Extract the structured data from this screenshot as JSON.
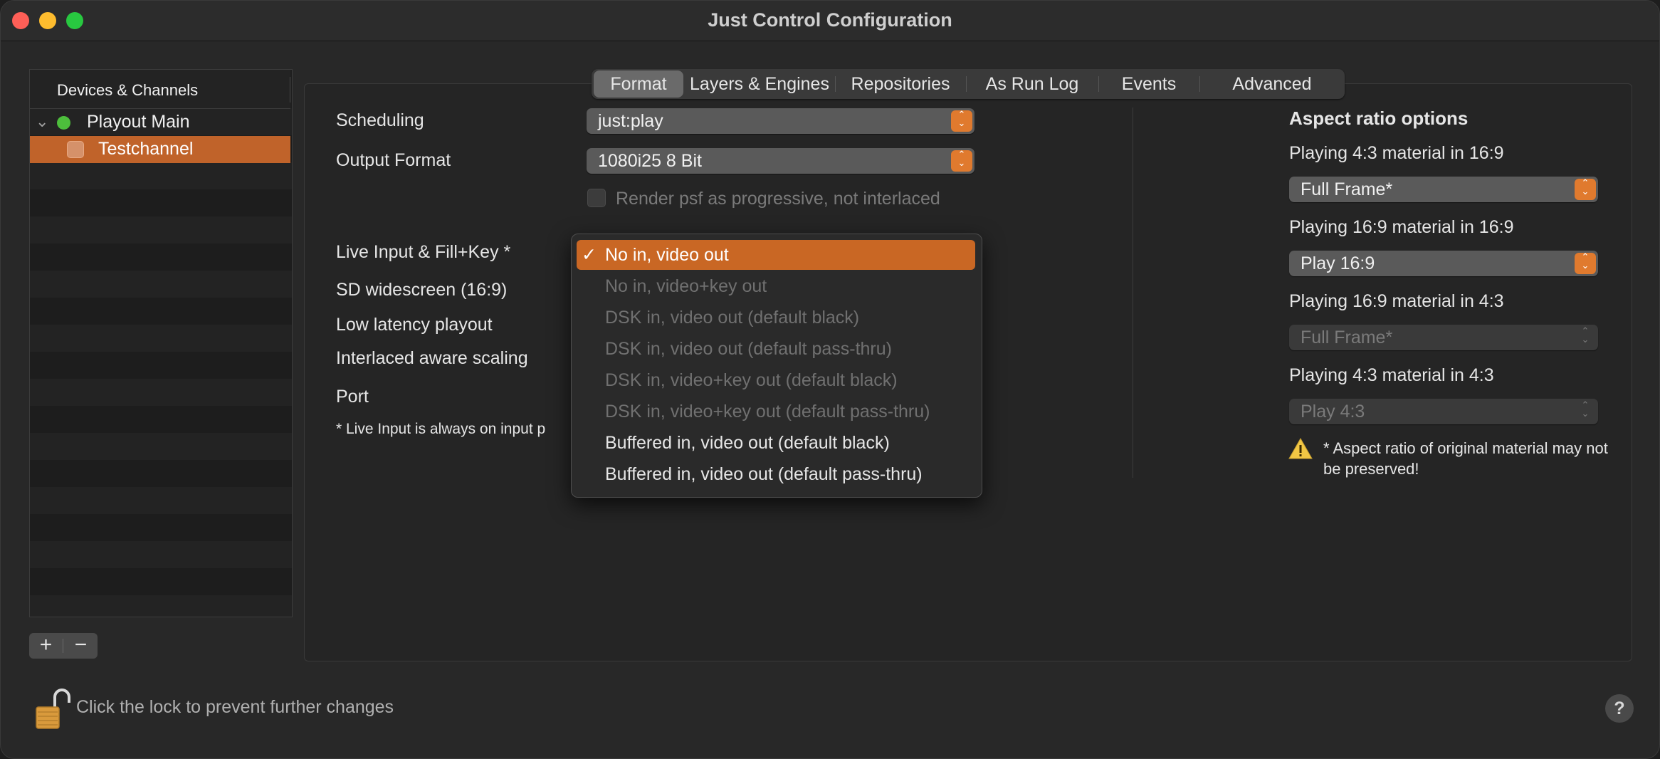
{
  "window": {
    "title": "Just Control Configuration"
  },
  "sidebar": {
    "header": "Devices & Channels",
    "items": [
      {
        "label": "Playout Main",
        "status_color": "#4dbe3c"
      },
      {
        "label": "Testchannel"
      }
    ],
    "add_label": "+",
    "remove_label": "−"
  },
  "tabs": [
    "Format",
    "Layers & Engines",
    "Repositories",
    "As Run Log",
    "Events",
    "Advanced"
  ],
  "selected_tab": "Format",
  "form": {
    "scheduling_label": "Scheduling",
    "scheduling_value": "just:play",
    "output_format_label": "Output Format",
    "output_format_value": "1080i25 8 Bit",
    "render_psf_label": "Render psf as progressive, not interlaced",
    "live_input_label": "Live Input & Fill+Key *",
    "sd_widescreen_label": "SD widescreen (16:9)",
    "low_latency_label": "Low latency playout",
    "interlaced_label": "Interlaced aware scaling",
    "port_label": "Port",
    "footnote": "* Live Input is always on input p"
  },
  "live_input_menu": {
    "items": [
      {
        "label": "No in, video out",
        "state": "selected"
      },
      {
        "label": "No in, video+key out",
        "state": "disabled"
      },
      {
        "label": "DSK in, video out (default black)",
        "state": "disabled"
      },
      {
        "label": "DSK in, video out (default pass-thru)",
        "state": "disabled"
      },
      {
        "label": "DSK in, video+key out (default black)",
        "state": "disabled"
      },
      {
        "label": "DSK in, video+key out (default pass-thru)",
        "state": "disabled"
      },
      {
        "label": "Buffered in, video out (default black)",
        "state": "enabled"
      },
      {
        "label": "Buffered in, video out (default pass-thru)",
        "state": "enabled"
      }
    ]
  },
  "aspect": {
    "title": "Aspect ratio options",
    "rows": [
      {
        "label": "Playing 4:3 material in 16:9",
        "value": "Full Frame*",
        "enabled": true
      },
      {
        "label": "Playing 16:9 material in 16:9",
        "value": "Play 16:9",
        "enabled": true
      },
      {
        "label": "Playing 16:9 material in 4:3",
        "value": "Full Frame*",
        "enabled": false
      },
      {
        "label": "Playing 4:3 material in 4:3",
        "value": "Play 4:3",
        "enabled": false
      }
    ],
    "warning": "* Aspect ratio of original material may not be preserved!"
  },
  "footer": {
    "lock_text": "Click the lock to prevent further changes",
    "help_label": "?"
  },
  "colors": {
    "accent": "#e07a2e",
    "selection": "#c0632a"
  }
}
